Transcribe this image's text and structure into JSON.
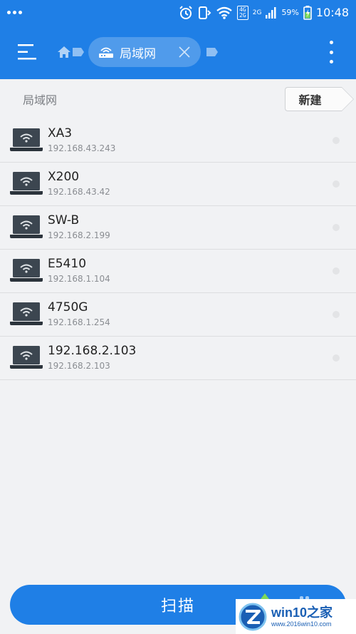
{
  "status_bar": {
    "chip_top": "4G",
    "chip_bottom": "2G",
    "network_small": "2G",
    "battery_percent": "59%",
    "time": "10:48"
  },
  "app_bar": {
    "breadcrumb_active_label": "局域网"
  },
  "section": {
    "title": "局域网",
    "new_button_label": "新建"
  },
  "devices": [
    {
      "name": "XA3",
      "ip": "192.168.43.243"
    },
    {
      "name": "X200",
      "ip": "192.168.43.42"
    },
    {
      "name": "SW-B",
      "ip": "192.168.2.199"
    },
    {
      "name": "E5410",
      "ip": "192.168.1.104"
    },
    {
      "name": "4750G",
      "ip": "192.168.1.254"
    },
    {
      "name": "192.168.2.103",
      "ip": "192.168.2.103"
    }
  ],
  "scan_button_label": "扫描",
  "watermark": {
    "brand": "win10之家",
    "url": "www.2016win10.com"
  },
  "colors": {
    "primary": "#1f7fe6",
    "background": "#f1f2f4",
    "divider": "#dcdde0"
  },
  "icons": {
    "menu": "hamburger-menu-icon",
    "home": "home-icon",
    "router": "router-icon",
    "close": "close-icon",
    "more": "more-vertical-icon",
    "device": "laptop-wifi-icon"
  }
}
